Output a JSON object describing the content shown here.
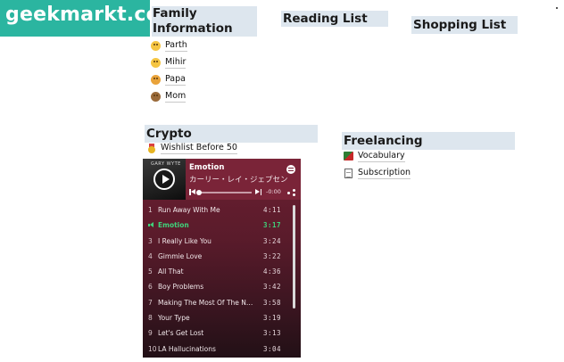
{
  "watermark": {
    "text": "geekmarkt.com"
  },
  "family": {
    "heading": "Family Information",
    "items": [
      {
        "label": "Parth",
        "icon": "grinning-face-icon"
      },
      {
        "label": "Mihir",
        "icon": "partying-face-icon"
      },
      {
        "label": "Papa",
        "icon": "cat-face-icon"
      },
      {
        "label": "Mom",
        "icon": "monkey-face-icon"
      }
    ]
  },
  "reading": {
    "heading": "Reading List"
  },
  "shopping": {
    "heading": "Shopping List"
  },
  "crypto": {
    "heading": "Crypto",
    "items": [
      {
        "label": "Wishlist Before 50",
        "icon": "medal-icon"
      }
    ]
  },
  "freelancing": {
    "heading": "Freelancing",
    "items": [
      {
        "label": "Vocabulary",
        "icon": "books-icon"
      },
      {
        "label": "Subscription",
        "icon": "document-icon"
      }
    ]
  },
  "player": {
    "cover_text": "GARY WYTE",
    "now_playing": {
      "title": "Emotion",
      "artist": "カーリー・レイ・ジェプセン"
    },
    "time": "-0:00",
    "progress": 0,
    "colors": {
      "accent": "#3fd27a",
      "header": "#7a2438"
    },
    "tracks": [
      {
        "num": "1",
        "name": "Run Away With Me",
        "duration": "4:11"
      },
      {
        "num": "",
        "name": "Emotion",
        "duration": "3:17",
        "active": true
      },
      {
        "num": "3",
        "name": "I Really Like You",
        "duration": "3:24"
      },
      {
        "num": "4",
        "name": "Gimmie Love",
        "duration": "3:22"
      },
      {
        "num": "5",
        "name": "All That",
        "duration": "4:36"
      },
      {
        "num": "6",
        "name": "Boy Problems",
        "duration": "3:42"
      },
      {
        "num": "7",
        "name": "Making The Most Of The Ni...",
        "duration": "3:58"
      },
      {
        "num": "8",
        "name": "Your Type",
        "duration": "3:19"
      },
      {
        "num": "9",
        "name": "Let's Get Lost",
        "duration": "3:13"
      },
      {
        "num": "10",
        "name": "LA Hallucinations",
        "duration": "3:04"
      }
    ]
  }
}
